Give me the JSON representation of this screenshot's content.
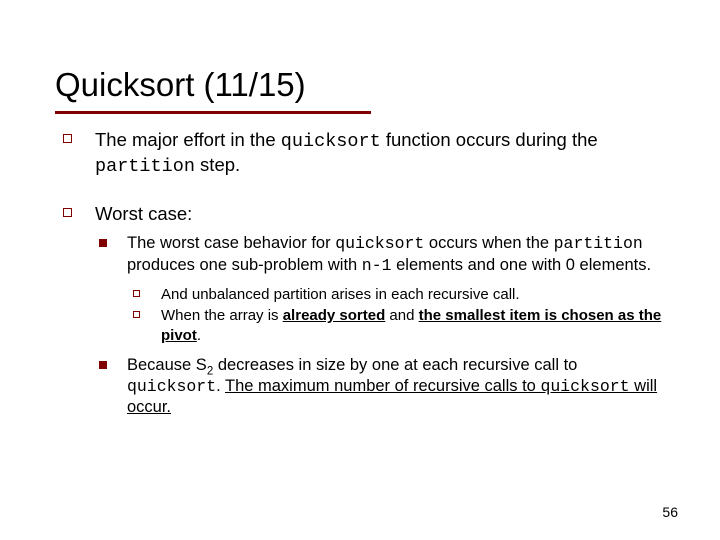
{
  "title": "Quicksort (11/15)",
  "points": [
    {
      "pre1": "The major effort in the ",
      "code1": "quicksort",
      "mid1": " function occurs during the ",
      "code2": "partition",
      "post1": " step."
    },
    {
      "heading": "Worst case:",
      "sub": [
        {
          "pre1": "The worst case behavior for ",
          "code1": "quicksort",
          "mid1": " occurs when the ",
          "code2": "partition",
          "mid2": " produces one sub-problem with ",
          "code3": "n-1",
          "post1": " elements and one with 0 elements.",
          "subsub": [
            {
              "text": "And unbalanced partition arises in each recursive call."
            },
            {
              "pre": "When the array is ",
              "b1": "already sorted",
              "mid": " and ",
              "b2": "the smallest item is chosen as the pivot",
              "post": "."
            }
          ]
        },
        {
          "pre1": "Because S",
          "subscript": "2",
          "mid1": " decreases in size by one at each recursive call to ",
          "code1": "quicksort",
          "mid2": ". ",
          "u_pre": "The maximum number of recursive calls to ",
          "u_code": "quicksort",
          "u_post": " will occur."
        }
      ]
    }
  ],
  "page_number": "56"
}
